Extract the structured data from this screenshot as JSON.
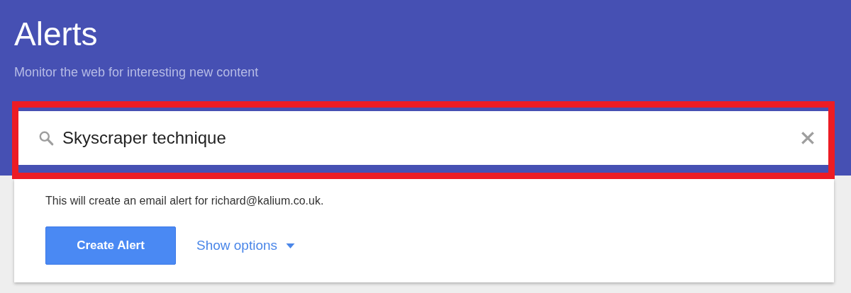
{
  "header": {
    "title": "Alerts",
    "subtitle": "Monitor the web for interesting new content"
  },
  "search": {
    "value": "Skyscraper technique",
    "highlighted": true
  },
  "card": {
    "message": "This will create an email alert for richard@kalium.co.uk.",
    "button": "Create Alert",
    "options_link": "Show options"
  }
}
